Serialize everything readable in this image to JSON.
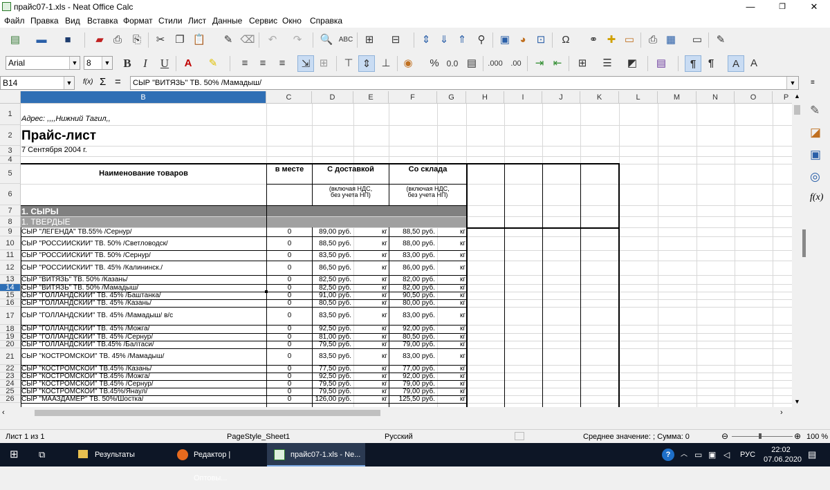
{
  "window": {
    "title": "прайс07-1.xls - Neat Office Calc",
    "minimize": "—",
    "restore": "❐",
    "close": "✕"
  },
  "menu": [
    "Файл",
    "Правка",
    "Вид",
    "Вставка",
    "Формат",
    "Стили",
    "Лист",
    "Данные",
    "Сервис",
    "Окно",
    "Справка"
  ],
  "font": {
    "name": "Arial",
    "size": "8"
  },
  "format_buttons": {
    "bold": "B",
    "italic": "I",
    "underline": "U",
    "percent": "%",
    "decimal": "0.0",
    "add_decimal": ".000",
    "remove_decimal": ".00"
  },
  "formula_bar": {
    "cell_ref": "B14",
    "fx": "f(x)",
    "sum": "Σ",
    "equals": "=",
    "content": "СЫР \"ВИТЯЗЬ\" ТВ. 50% /Мамадыш/"
  },
  "columns": [
    "B",
    "C",
    "D",
    "E",
    "F",
    "G",
    "H",
    "I",
    "J",
    "K",
    "L",
    "M",
    "N",
    "O",
    "P"
  ],
  "sheet": {
    "address": "Адрес: ,,,,Нижний Тагил,,",
    "title": "Прайс-лист",
    "date": "7 Сентября 2004 г.",
    "header": {
      "name": "Наименование товаров",
      "in_place": "в месте",
      "delivery": "С доставкой",
      "warehouse": "Со склада",
      "note_delivery": "(включая НДС,\nбез учета НП)",
      "note_warehouse": "(включая НДС,\nбез учета НП)"
    },
    "section": "1. СЫРЫ",
    "subsection": "1. ТВЕРДЫЕ",
    "rows": [
      {
        "row": "9",
        "name": "СЫР  \"ЛЕГЕНДА\" ТВ.55% /Сернур/",
        "c": "0",
        "d": "89,00 руб.",
        "e": "кг",
        "f": "88,50 руб.",
        "g": "кг"
      },
      {
        "row": "10",
        "name": "СЫР  \"РОССИЙСКИЙ\" ТВ. 50%  /Светловодск/",
        "c": "0",
        "d": "88,50 руб.",
        "e": "кг",
        "f": "88,00 руб.",
        "g": "кг"
      },
      {
        "row": "11",
        "name": "СЫР  \"РОССИЙСКИЙ\" ТВ. 50%  /Сернур/",
        "c": "0",
        "d": "83,50 руб.",
        "e": "кг",
        "f": "83,00 руб.",
        "g": "кг"
      },
      {
        "row": "12",
        "name": "СЫР  \"РОССИЙСКИЙ\" ТВ. 45% /Калининск./",
        "c": "0",
        "d": "86,50 руб.",
        "e": "кг",
        "f": "86,00 руб.",
        "g": "кг"
      },
      {
        "row": "13",
        "name": "СЫР \"ВИТЯЗЬ\" ТВ. 50% /Казань/",
        "c": "0",
        "d": "82,50 руб.",
        "e": "кг",
        "f": "82,00 руб.",
        "g": "кг"
      },
      {
        "row": "14",
        "name": "СЫР \"ВИТЯЗЬ\" ТВ. 50% /Мамадыш/",
        "c": "0",
        "d": "82,50 руб.",
        "e": "кг",
        "f": "82,00 руб.",
        "g": "кг"
      },
      {
        "row": "15",
        "name": "СЫР \"ГОЛЛАНДСКИЙ\" ТВ. 45% /Баштанка/",
        "c": "0",
        "d": "91,00 руб.",
        "e": "кг",
        "f": "90,50 руб.",
        "g": "кг"
      },
      {
        "row": "16",
        "name": "СЫР \"ГОЛЛАНДСКИЙ\" ТВ. 45% /Казань/",
        "c": "0",
        "d": "80,50 руб.",
        "e": "кг",
        "f": "80,00 руб.",
        "g": "кг"
      },
      {
        "row": "17",
        "name": "СЫР \"ГОЛЛАНДСКИЙ\" ТВ. 45% /Мамадыш/ в/с",
        "c": "0",
        "d": "83,50 руб.",
        "e": "кг",
        "f": "83,00 руб.",
        "g": "кг"
      },
      {
        "row": "18",
        "name": "СЫР \"ГОЛЛАНДСКИЙ\" ТВ. 45% /Можга/",
        "c": "0",
        "d": "92,50 руб.",
        "e": "кг",
        "f": "92,00 руб.",
        "g": "кг"
      },
      {
        "row": "19",
        "name": "СЫР \"ГОЛЛАНДСКИЙ\" ТВ. 45% /Сернур/",
        "c": "0",
        "d": "81,00 руб.",
        "e": "кг",
        "f": "80,50 руб.",
        "g": "кг"
      },
      {
        "row": "20",
        "name": "СЫР \"ГОЛЛАНДСКИЙ\" ТВ.45% /Балтаси/",
        "c": "0",
        "d": "79,50 руб.",
        "e": "кг",
        "f": "79,00 руб.",
        "g": "кг"
      },
      {
        "row": "21",
        "name": "СЫР \"КОСТРОМСКОЙ\" ТВ. 45% /Мамадыш/",
        "c": "0",
        "d": "83,50 руб.",
        "e": "кг",
        "f": "83,00 руб.",
        "g": "кг"
      },
      {
        "row": "22",
        "name": "СЫР \"КОСТРОМСКОЙ\" ТВ.45% /Казань/",
        "c": "0",
        "d": "77,50 руб.",
        "e": "кг",
        "f": "77,00 руб.",
        "g": "кг"
      },
      {
        "row": "23",
        "name": "СЫР \"КОСТРОМСКОЙ\" ТВ.45% /Можга/",
        "c": "0",
        "d": "92,50 руб.",
        "e": "кг",
        "f": "92,00 руб.",
        "g": "кг"
      },
      {
        "row": "24",
        "name": "СЫР \"КОСТРОМСКОЙ\" ТВ.45% /Сернур/",
        "c": "0",
        "d": "79,50 руб.",
        "e": "кг",
        "f": "79,00 руб.",
        "g": "кг"
      },
      {
        "row": "25",
        "name": "СЫР \"КОСТРОМСКОЙ\" ТВ.45%/Янаул/",
        "c": "0",
        "d": "79,50 руб.",
        "e": "кг",
        "f": "79,00 руб.",
        "g": "кг"
      },
      {
        "row": "26",
        "name": "СЫР \"МААЗДАМЕР\" ТВ. 50%/Шостка/",
        "c": "0",
        "d": "126,00 руб.",
        "e": "кг",
        "f": "125,50 руб.",
        "g": "кг"
      }
    ],
    "header_rows": [
      "1",
      "2",
      "3",
      "4",
      "5",
      "6",
      "7",
      "8"
    ]
  },
  "status": {
    "sheet": "Лист 1 из 1",
    "page_style": "PageStyle_Sheet1",
    "language": "Русский",
    "summary": "Среднее значение: ; Сумма: 0",
    "zoom_minus": "⊖",
    "zoom_plus": "⊕",
    "zoom": "100 %"
  },
  "taskbar": {
    "items": [
      "Результаты",
      "Редактор | Оптовы...",
      "прайс07-1.xls - Ne..."
    ],
    "lang": "РУС",
    "time": "22:02",
    "date": "07.06.2020"
  },
  "colors": {
    "selected_header": "#2f6fb5",
    "section_bg": "#808080",
    "subsection_bg": "#a0a0a0",
    "taskbar": "#0d1626"
  }
}
